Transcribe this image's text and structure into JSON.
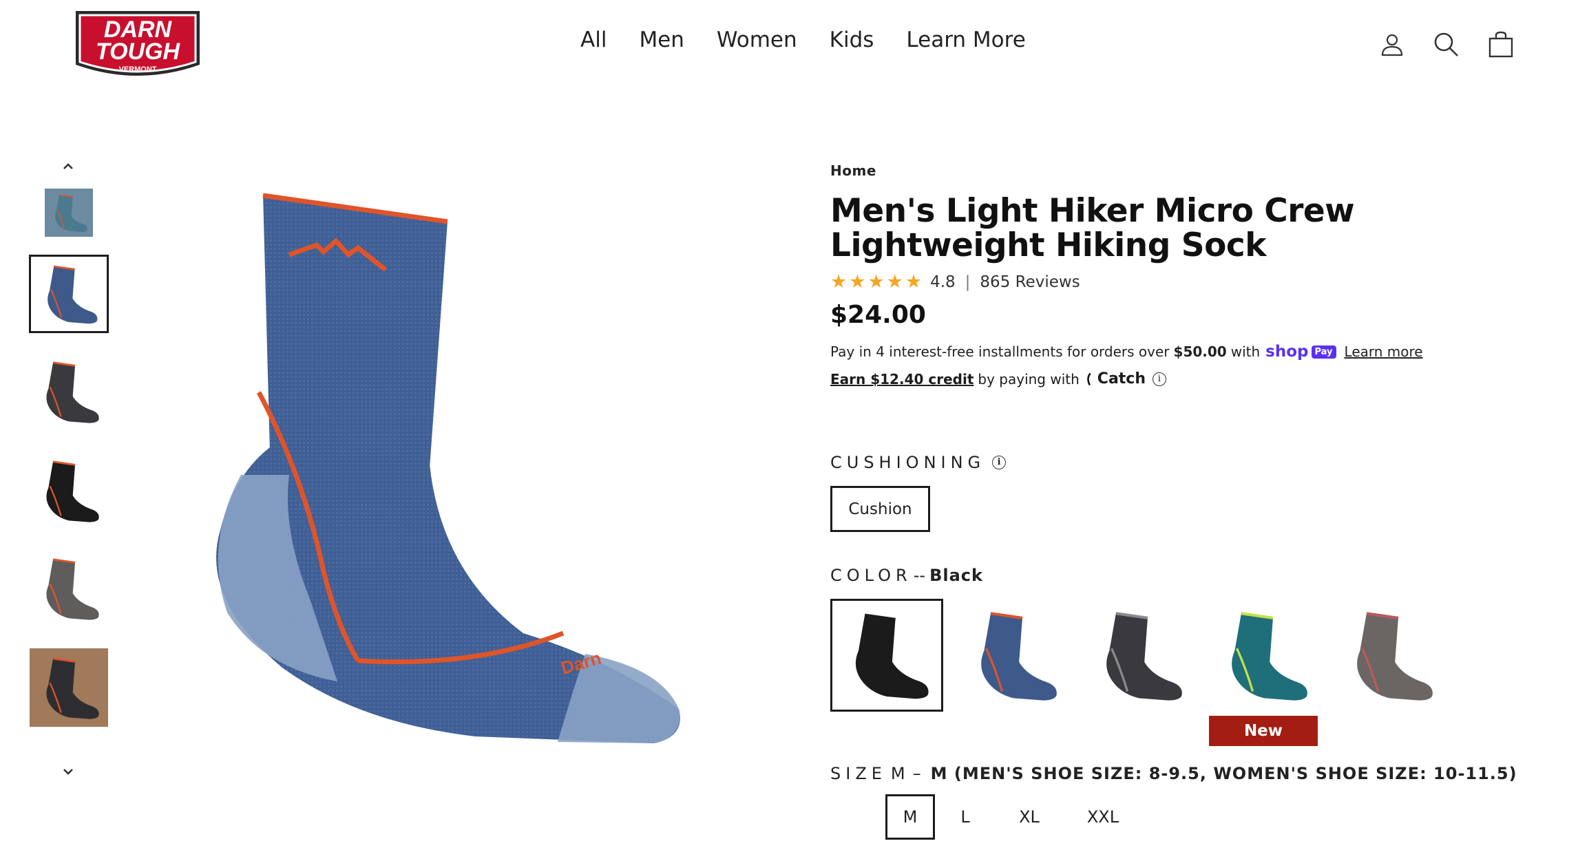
{
  "header": {
    "logo": {
      "line1": "DARN",
      "line2": "TOUGH",
      "line3": "VERMONT"
    },
    "nav": [
      "All",
      "Men",
      "Women",
      "Kids",
      "Learn More"
    ],
    "icons": [
      "account-icon",
      "search-icon",
      "cart-icon"
    ]
  },
  "gallery": {
    "thumbnails": [
      {
        "name": "hiker-boots-photo",
        "colors": {
          "bg": "#6c8aa0",
          "sock": "#4b7a8e"
        }
      },
      {
        "name": "denim-sock",
        "colors": {
          "bg": "#ffffff",
          "sock": "#3d5a8a"
        }
      },
      {
        "name": "charcoal-sock",
        "colors": {
          "bg": "#ffffff",
          "sock": "#3a3a3e"
        }
      },
      {
        "name": "black-sock",
        "colors": {
          "bg": "#ffffff",
          "sock": "#1b1b1b"
        }
      },
      {
        "name": "gray-sock",
        "colors": {
          "bg": "#ffffff",
          "sock": "#5f5d5b"
        }
      },
      {
        "name": "sitting-hiker-photo",
        "colors": {
          "bg": "#a07a5a",
          "sock": "#2e2e32"
        }
      }
    ],
    "active_index": 1
  },
  "product": {
    "breadcrumb": "Home",
    "title": "Men's Light Hiker Micro Crew Lightweight Hiking Sock",
    "rating": "4.8",
    "rating_sep": "|",
    "reviews": "865 Reviews",
    "price": "$24.00",
    "pay": {
      "text_before": "Pay in 4 interest-free installments for orders over",
      "amount": "$50.00",
      "text_after": "with",
      "shop_word": "shop",
      "pay_badge": "Pay",
      "learn_more": "Learn more"
    },
    "catch": {
      "earn": "Earn $12.40 credit",
      "text": "by paying with",
      "brand": "Catch"
    }
  },
  "options": {
    "cushioning": {
      "label": "CUSHIONING",
      "values": [
        "Cushion"
      ],
      "selected": "Cushion"
    },
    "color": {
      "label": "COLOR",
      "separator": "--",
      "selected": "Black",
      "swatches": [
        {
          "name": "black",
          "sock": "#1b1b1b",
          "accent": "#1b1b1b"
        },
        {
          "name": "denim",
          "sock": "#3d5a8a",
          "accent": "#d9542c"
        },
        {
          "name": "charcoal",
          "sock": "#3a3a3e",
          "accent": "#8a8a8e"
        },
        {
          "name": "teal",
          "sock": "#1e6f7a",
          "accent": "#c6e04a"
        },
        {
          "name": "gray",
          "sock": "#6b6663",
          "accent": "#b85b5b"
        }
      ],
      "new_badge": "New"
    },
    "size": {
      "label": "SIZE",
      "selected": "M",
      "dash": "–",
      "detail": "M (MEN'S SHOE SIZE: 8-9.5, WOMEN'S SHOE SIZE: 10-11.5)",
      "values": [
        "M",
        "L",
        "XL",
        "XXL"
      ]
    }
  },
  "colors": {
    "accent": "#5a31f4",
    "badge": "#a41d12",
    "star": "#f5a623"
  }
}
